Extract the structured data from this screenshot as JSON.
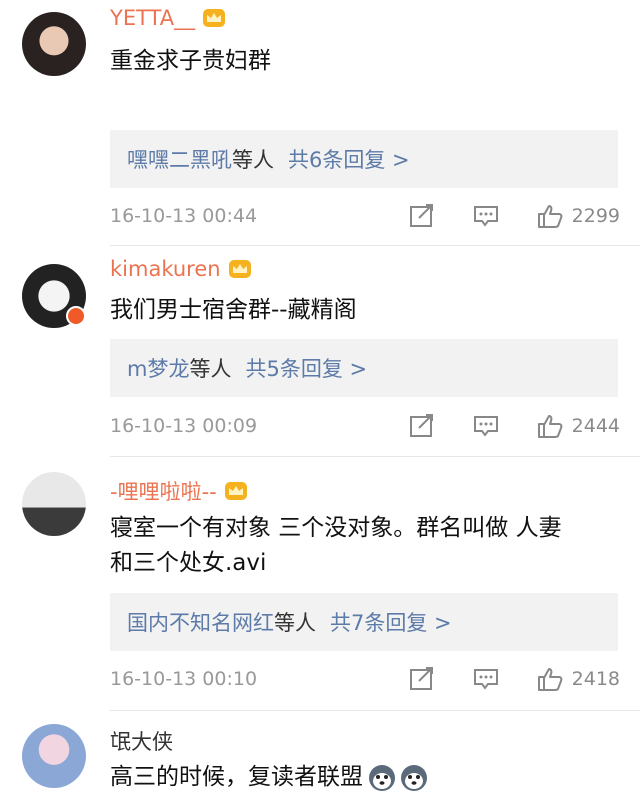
{
  "colors": {
    "username": "#eb7350",
    "link": "#5d7ba8",
    "meta": "#999999",
    "reply_bg": "#f2f2f2"
  },
  "comments": [
    {
      "username": "YETTA__",
      "text": [
        "重金求子贵妇群"
      ],
      "reply_names": "嘿嘿二黑吼",
      "reply_etc": "等人",
      "reply_count": "共6条回复 >",
      "time": "16-10-13 00:44",
      "likes": "2299"
    },
    {
      "username": "kimakuren",
      "text": [
        "我们男士宿舍群--藏精阁"
      ],
      "reply_names": "m梦龙",
      "reply_etc": "等人",
      "reply_count": "共5条回复 >",
      "time": "16-10-13 00:09",
      "likes": "2444"
    },
    {
      "username": "-哩哩啦啦--",
      "text": [
        "寝室一个有对象 三个没对象。群名叫做 人妻",
        "和三个处女.avi"
      ],
      "reply_names": "国内不知名网红",
      "reply_etc": "等人",
      "reply_count": "共7条回复 >",
      "time": "16-10-13 00:10",
      "likes": "2418"
    },
    {
      "username": "氓大侠",
      "text": [
        "高三的时候，复读者联盟"
      ]
    }
  ],
  "icons": {
    "crown": "crown-icon",
    "share": "share-icon",
    "comment": "comment-icon",
    "like": "thumbs-up-icon",
    "emoji": "husky-emoji-icon"
  }
}
